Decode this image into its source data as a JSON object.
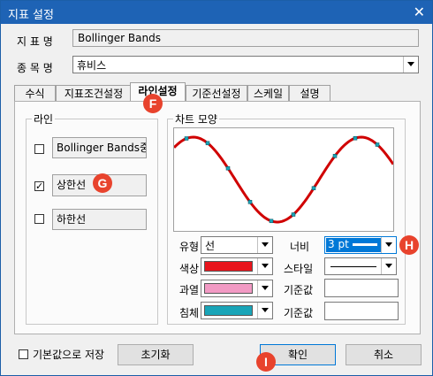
{
  "window": {
    "title": "지표 설정",
    "close_glyph": "✕"
  },
  "indicator_name": {
    "label": "지 표 명",
    "value": "Bollinger Bands"
  },
  "item_name": {
    "label": "종 목 명",
    "value": "휴비스"
  },
  "tabs": [
    {
      "label": "수식"
    },
    {
      "label": "지표조건설정"
    },
    {
      "label": "라인설정"
    },
    {
      "label": "기준선설정"
    },
    {
      "label": "스케일"
    },
    {
      "label": "설명"
    }
  ],
  "line_group": {
    "title": "라인",
    "items": [
      {
        "label": "Bollinger Bands중",
        "checked": false,
        "check_glyph": ""
      },
      {
        "label": "상한선",
        "checked": true,
        "check_glyph": "✓"
      },
      {
        "label": "하한선",
        "checked": false,
        "check_glyph": ""
      }
    ]
  },
  "chart_shape": {
    "title": "차트 모양",
    "line_color": "#d00000",
    "marker_color": "#1aa5b8",
    "type": {
      "label": "유형",
      "value": "선"
    },
    "color": {
      "label": "색상",
      "swatch": "#e8141c"
    },
    "overbought": {
      "label": "과열",
      "swatch": "#f29ac4"
    },
    "oversold": {
      "label": "침체",
      "swatch": "#1aa5b8"
    },
    "width": {
      "label": "너비",
      "value": "3 pt"
    },
    "style": {
      "label": "스타일"
    },
    "baseline1": {
      "label": "기준값",
      "value": ""
    },
    "baseline2": {
      "label": "기준값",
      "value": ""
    }
  },
  "footer": {
    "save_default_label": "기본값으로 저장",
    "reset_label": "초기화",
    "ok_label": "확인",
    "cancel_label": "취소"
  },
  "annotations": [
    {
      "letter": "F"
    },
    {
      "letter": "G"
    },
    {
      "letter": "H"
    },
    {
      "letter": "I"
    }
  ]
}
